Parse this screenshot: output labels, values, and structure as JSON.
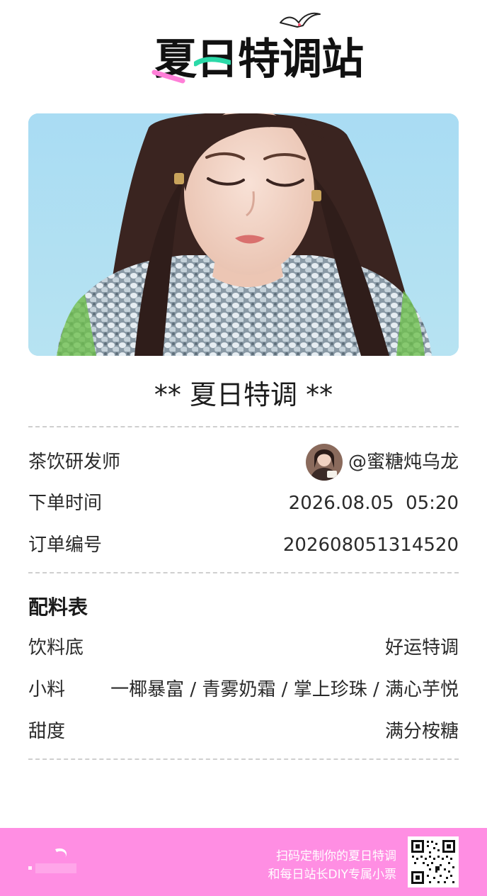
{
  "logo": {
    "text": "夏日特调站",
    "icon": "seagull-icon"
  },
  "photo": {
    "icon": "portrait-photo"
  },
  "receipt": {
    "title": "** 夏日特调 **",
    "tea_developer_label": "茶饮研发师",
    "tea_developer_value": "@蜜糖炖乌龙",
    "order_time_label": "下单时间",
    "order_time_value": "2026.08.05  05:20",
    "order_number_label": "订单编号",
    "order_number_value": "202608051314520"
  },
  "ingredients": {
    "section_title": "配料表",
    "base_label": "饮料底",
    "base_value": "好运特调",
    "toppings_label": "小料",
    "toppings_value": "一椰暴富 / 青雾奶霜 / 掌上珍珠 / 满心芋悦",
    "sweetness_label": "甜度",
    "sweetness_value": "满分桉糖"
  },
  "footer": {
    "line1": "扫码定制你的夏日特调",
    "line2": "和每日站长DIY专属小票",
    "qr_icon": "qr-code-icon"
  },
  "colors": {
    "footer_bg": "#ff8ee3",
    "logo_green": "#2bd9a8",
    "logo_pink": "#ff7fd8",
    "photo_sky": "#a7dcf1"
  }
}
